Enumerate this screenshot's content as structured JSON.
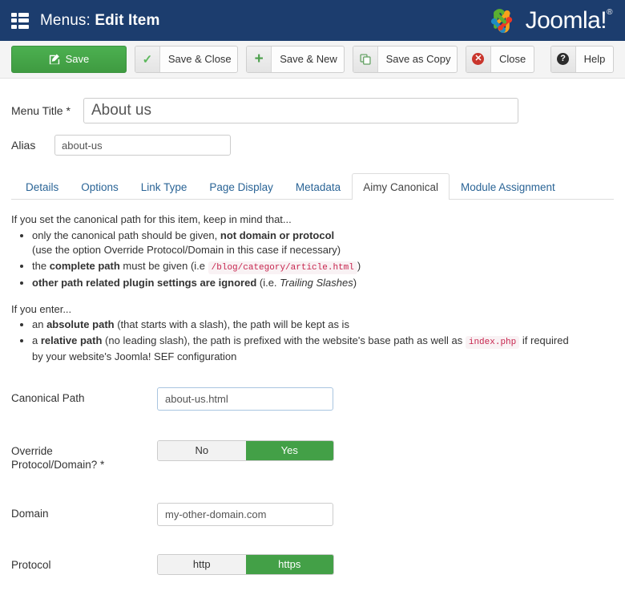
{
  "header": {
    "menu_icon": "list-layout-icon",
    "title_prefix": "Menus:",
    "title_suffix": "Edit Item",
    "brand_name": "Joomla!",
    "brand_trademark": "®",
    "background_color": "#1c3d6e"
  },
  "toolbar": {
    "save_label": "Save",
    "save_close_label": "Save & Close",
    "save_new_label": "Save & New",
    "save_copy_label": "Save as Copy",
    "close_label": "Close",
    "help_label": "Help",
    "save_color": "#46a546",
    "close_icon_color": "#c9352c"
  },
  "form": {
    "menu_title_label": "Menu Title *",
    "menu_title_value": "About us",
    "menu_title_placeholder": "",
    "alias_label": "Alias",
    "alias_value": "about-us",
    "alias_placeholder": ""
  },
  "tabs": [
    {
      "label": "Details",
      "active": false
    },
    {
      "label": "Options",
      "active": false
    },
    {
      "label": "Link Type",
      "active": false
    },
    {
      "label": "Page Display",
      "active": false
    },
    {
      "label": "Metadata",
      "active": false
    },
    {
      "label": "Aimy Canonical",
      "active": true
    },
    {
      "label": "Module Assignment",
      "active": false
    }
  ],
  "help": {
    "intro1": "If you set the canonical path for this item, keep in mind that...",
    "b1_pre": "only the canonical path should be given, ",
    "b1_bold": "not domain or protocol",
    "b1_sub": "(use the option Override Protocol/Domain in this case if necessary)",
    "b2_pre": "the ",
    "b2_bold": "complete path",
    "b2_mid": " must be given (i.e ",
    "b2_code": "/blog/category/article.html",
    "b2_post": ")",
    "b3_bold": "other path related plugin settings are ignored",
    "b3_mid": " (i.e. ",
    "b3_italic": "Trailing Slashes",
    "b3_post": ")",
    "intro2": "If you enter...",
    "b4_pre": "an ",
    "b4_bold": "absolute path",
    "b4_post": " (that starts with a slash), the path will be kept as is",
    "b5_pre": "a ",
    "b5_bold": "relative path",
    "b5_mid": " (no leading slash), the path is prefixed with the website's base path as well as ",
    "b5_code": "index.php",
    "b5_post": " if required",
    "b5_line2": "by your website's Joomla! SEF configuration"
  },
  "settings": {
    "canonical_path_label": "Canonical Path",
    "canonical_path_value": "about-us.html",
    "canonical_path_placeholder": "",
    "override_label_line1": "Override",
    "override_label_line2": "Protocol/Domain? *",
    "override_option_no": "No",
    "override_option_yes": "Yes",
    "override_selected": "Yes",
    "domain_label": "Domain",
    "domain_value": "my-other-domain.com",
    "domain_placeholder": "",
    "protocol_label": "Protocol",
    "protocol_option_http": "http",
    "protocol_option_https": "https",
    "protocol_selected": "https",
    "toggle_on_color": "#43a047"
  }
}
